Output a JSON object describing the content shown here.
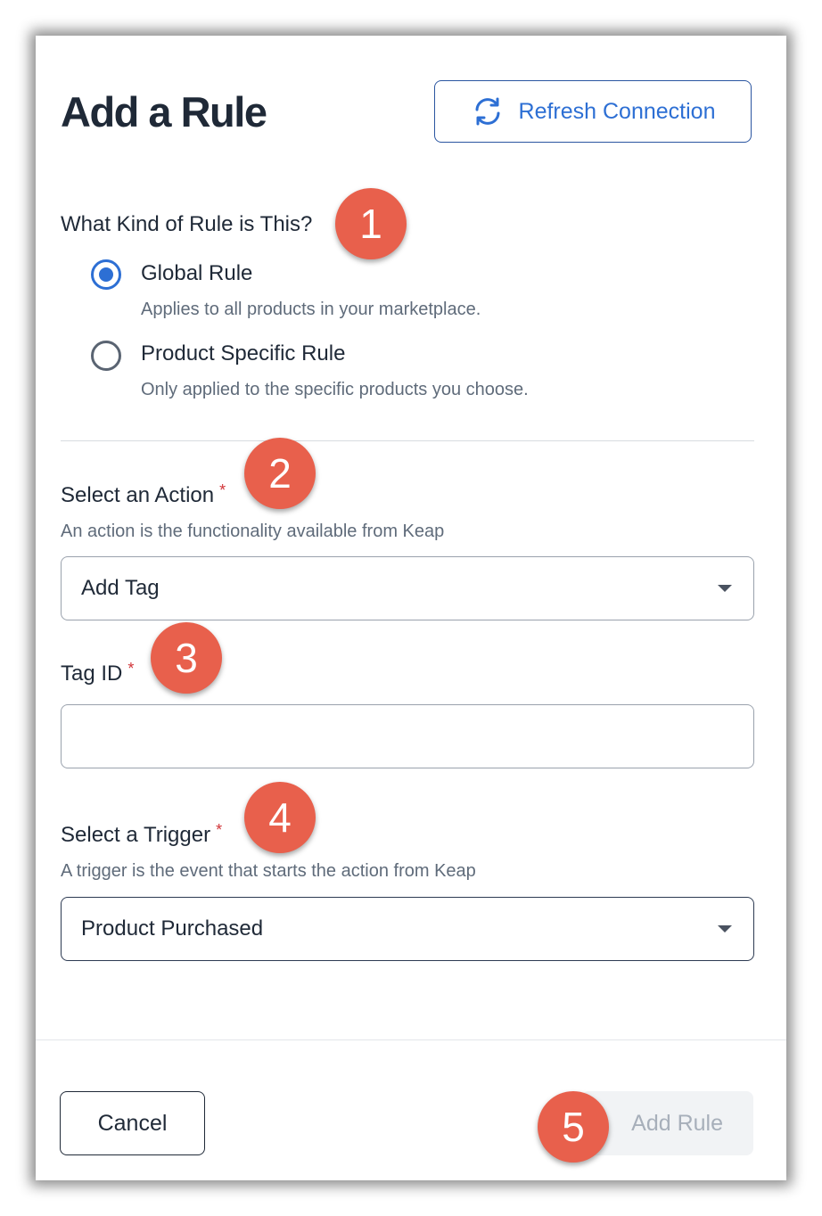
{
  "modal": {
    "title": "Add a Rule",
    "refresh_label": "Refresh Connection"
  },
  "rule_kind": {
    "question": "What Kind of Rule is This?",
    "options": [
      {
        "label": "Global Rule",
        "description": "Applies to all products in your marketplace.",
        "selected": true
      },
      {
        "label": "Product Specific Rule",
        "description": "Only applied to the specific products you choose.",
        "selected": false
      }
    ]
  },
  "action": {
    "label": "Select an Action",
    "required_marker": "*",
    "help": "An action is the functionality available from Keap",
    "value": "Add Tag"
  },
  "tag_id": {
    "label": "Tag ID",
    "required_marker": "*",
    "value": ""
  },
  "trigger": {
    "label": "Select a Trigger",
    "required_marker": "*",
    "help": "A trigger is the event that starts the action from Keap",
    "value": "Product Purchased"
  },
  "footer": {
    "cancel_label": "Cancel",
    "add_label": "Add Rule"
  },
  "badges": [
    "1",
    "2",
    "3",
    "4",
    "5"
  ],
  "colors": {
    "accent": "#2d6fd4",
    "badge": "#e8604c",
    "required": "#d13438",
    "text": "#1f2937",
    "muted": "#5f6b7a"
  }
}
